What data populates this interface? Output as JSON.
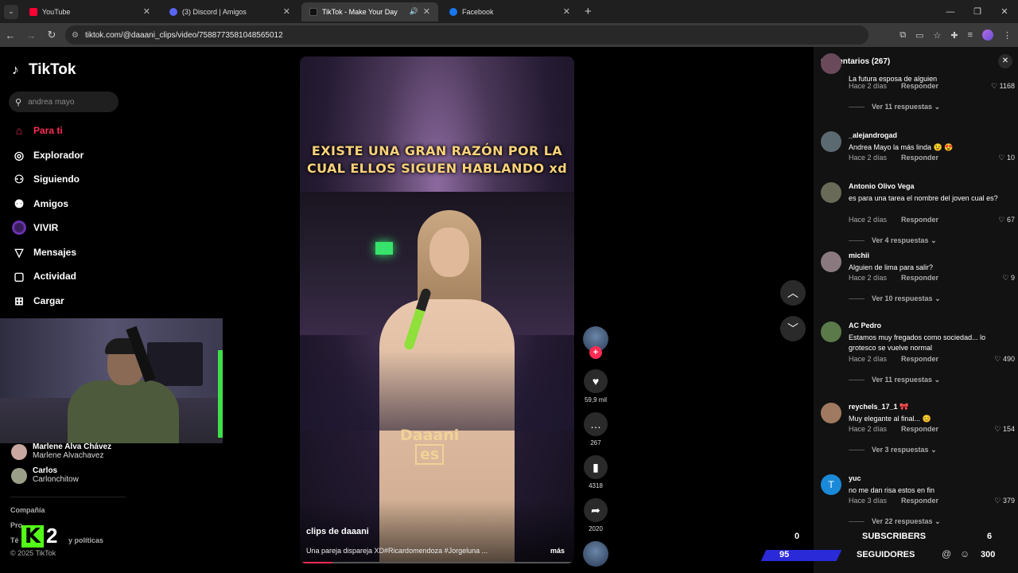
{
  "browser": {
    "tabs": [
      {
        "label": "YouTube",
        "color": "#ff0033"
      },
      {
        "label": "(3) Discord | Amigos",
        "color": "#5865f2"
      },
      {
        "label": "TikTok - Make Your Day",
        "color": "#000000"
      },
      {
        "label": "Facebook",
        "color": "#1877f2"
      }
    ],
    "url": "tiktok.com/@daaani_clips/video/7588773581048565012"
  },
  "sidebar": {
    "logo": "TikTok",
    "search_placeholder": "andrea mayo",
    "nav": [
      {
        "label": "Para ti",
        "icon": "home-icon"
      },
      {
        "label": "Explorador",
        "icon": "compass-icon"
      },
      {
        "label": "Siguiendo",
        "icon": "following-icon"
      },
      {
        "label": "Amigos",
        "icon": "friends-icon"
      },
      {
        "label": "VIVIR",
        "icon": "live-icon"
      },
      {
        "label": "Mensajes",
        "icon": "send-icon"
      },
      {
        "label": "Actividad",
        "icon": "activity-icon"
      },
      {
        "label": "Cargar",
        "icon": "upload-icon"
      }
    ],
    "following": [
      {
        "name": "Marlene Alva Chávez",
        "user": "Marlene Alvachavez"
      },
      {
        "name": "Carlos",
        "user": "Carlonchitow"
      }
    ],
    "footer": [
      "Compañía",
      "Pro",
      "Té",
      "y políticas",
      "© 2025 TikTok"
    ]
  },
  "overlay": {
    "kick_letter": "K",
    "kick_number": "2",
    "subscribers_label": "SUBSCRIBERS",
    "subscribers_left": "0",
    "subscribers_right": "6",
    "followers_label": "SEGUIDORES",
    "followers_left": "95",
    "followers_right": "300"
  },
  "video": {
    "caption_line1": "EXISTE UNA GRAN RAZÓN POR LA",
    "caption_line2": "CUAL ELLOS SIGUEN HABLANDO xd",
    "watermark_top": "Daaani",
    "watermark_bottom": "es",
    "author": "clips de daaani",
    "description": "Una pareja dispareja XD#Ricardomendoza #Jorgeluna ...",
    "more": "más",
    "progress": 0.12,
    "likes": "59,9 mil",
    "comments": "267",
    "saves": "4318",
    "shares": "2020"
  },
  "comments_panel": {
    "title": "Comentarios (267)",
    "items": [
      {
        "user": "",
        "text": "La futura esposa de alguien",
        "time": "Hace 2 días",
        "reply": "Responder",
        "likes": "1168",
        "replies": "Ver 11 respuestas",
        "color": "#6a4a5a"
      },
      {
        "user": "_alejandrogad",
        "text": "Andrea Mayo la más linda 😉 😍",
        "time": "Hace 2 días",
        "reply": "Responder",
        "likes": "10",
        "replies": "",
        "color": "#5a6a70"
      },
      {
        "user": "Antonio Olivo Vega",
        "text": "es para una tarea el nombre del joven cual es?",
        "time": "Hace 2 días",
        "reply": "Responder",
        "likes": "67",
        "replies": "Ver 4 respuestas",
        "color": "#6a6a58"
      },
      {
        "user": "michii",
        "text": "Alguien de lima para salir?",
        "time": "Hace 2 días",
        "reply": "Responder",
        "likes": "9",
        "replies": "Ver 10 respuestas",
        "color": "#8a7a80"
      },
      {
        "user": "AC Pedro",
        "text": "Estamos muy fregados como sociedad... lo grotesco se vuelve normal",
        "time": "Hace 2 días",
        "reply": "Responder",
        "likes": "490",
        "replies": "Ver 11 respuestas",
        "color": "#5a7a4a"
      },
      {
        "user": "reychels_17_1 🎀",
        "text": "Muy elegante al final... 😊",
        "time": "Hace 2 días",
        "reply": "Responder",
        "likes": "154",
        "replies": "Ver 3 respuestas",
        "color": "#a07a60"
      },
      {
        "user": "yuc",
        "text": "no me dan risa estos en fin",
        "time": "Hace 3 días",
        "reply": "Responder",
        "likes": "379",
        "replies": "Ver 22 respuestas",
        "color": "#1a8ad8",
        "initial": "T"
      }
    ]
  }
}
